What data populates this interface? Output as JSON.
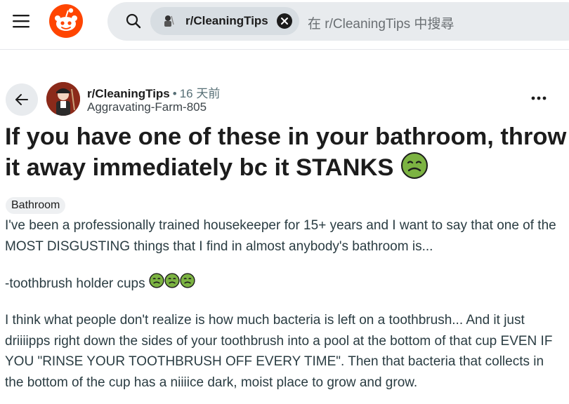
{
  "header": {
    "search": {
      "community_chip": "r/CleaningTips",
      "placeholder": "在 r/CleaningTips 中搜尋"
    }
  },
  "post": {
    "subreddit": "r/CleaningTips",
    "separator": "•",
    "time": "16 天前",
    "author": "Aggravating-Farm-805",
    "title": "If you have one of these in your bathroom, throw it away immediately bc it STANKS",
    "flair": "Bathroom",
    "body": [
      "I've been a professionally trained housekeeper for 15+ years and I want to say that one of the MOST DISGUSTING things that I find in almost anybody's bathroom is...",
      "-toothbrush holder cups",
      "I think what people don't realize is how much bacteria is left on a toothbrush... And it just driiiipps right down the sides of your toothbrush into a pool at the bottom of that cup EVEN IF YOU \"RINSE YOUR TOOTHBRUSH OFF EVERY TIME\". Then that bacteria that collects in the bottom of the cup has a niiiice dark, moist place to grow and grow."
    ]
  },
  "icons": {
    "menu": "hamburger-menu-icon",
    "logo": "reddit-logo",
    "search": "search-icon",
    "clear": "close-icon",
    "back": "arrow-left-icon",
    "more": "more-horizontal-icon",
    "emoji": "nauseated-face-emoji"
  },
  "colors": {
    "brand": "#ff4500",
    "search_bg": "#e8ebee",
    "chip_bg": "#d7dde2",
    "emoji_green": "#7cb342"
  }
}
